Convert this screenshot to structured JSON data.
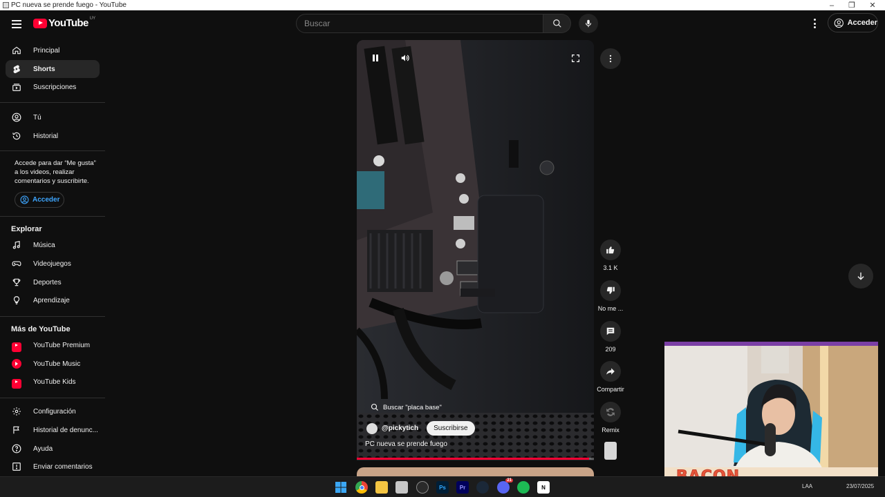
{
  "window": {
    "title": "PC nueva se prende fuego - YouTube",
    "minimize": "–",
    "restore": "❐",
    "close": "✕"
  },
  "header": {
    "logo_text": "YouTube",
    "country_code": "UY",
    "search_placeholder": "Buscar",
    "signin_label": "Acceder"
  },
  "sidebar": {
    "main": [
      {
        "label": "Principal",
        "icon": "home-icon"
      },
      {
        "label": "Shorts",
        "icon": "shorts-icon",
        "active": true
      },
      {
        "label": "Suscripciones",
        "icon": "subscriptions-icon"
      }
    ],
    "you": [
      {
        "label": "Tú",
        "icon": "user-icon"
      },
      {
        "label": "Historial",
        "icon": "history-icon"
      }
    ],
    "signin_prompt": "Accede para dar “Me gusta” a los videos, realizar comentarios y suscribirte.",
    "signin_label": "Acceder",
    "explore_title": "Explorar",
    "explore": [
      {
        "label": "Música",
        "icon": "music-icon"
      },
      {
        "label": "Videojuegos",
        "icon": "gaming-icon"
      },
      {
        "label": "Deportes",
        "icon": "trophy-icon"
      },
      {
        "label": "Aprendizaje",
        "icon": "bulb-icon"
      }
    ],
    "more_title": "Más de YouTube",
    "more": [
      {
        "label": "YouTube Premium",
        "icon": "youtube-premium-icon"
      },
      {
        "label": "YouTube Music",
        "icon": "youtube-music-icon"
      },
      {
        "label": "YouTube Kids",
        "icon": "youtube-kids-icon"
      }
    ],
    "settings": [
      {
        "label": "Configuración",
        "icon": "gear-icon"
      },
      {
        "label": "Historial de denunc...",
        "icon": "flag-icon"
      },
      {
        "label": "Ayuda",
        "icon": "help-icon"
      },
      {
        "label": "Enviar comentarios",
        "icon": "feedback-icon"
      }
    ]
  },
  "short": {
    "search_chip": "Buscar \"placa base\"",
    "channel": "@pickytich",
    "subscribe_label": "Suscribirse",
    "title": "PC nueva se prende fuego",
    "progress": 0.98
  },
  "actions": {
    "likes": "3.1 K",
    "dislike": "No me ...",
    "comments": "209",
    "share": "Compartir",
    "remix": "Remix"
  },
  "webcam": {
    "overlay_text": "BACON"
  },
  "taskbar": {
    "apps": [
      "windows-start-icon",
      "chrome-icon",
      "file-explorer-icon",
      "app-icon",
      "app-icon",
      "photoshop-icon",
      "premiere-icon",
      "steam-icon",
      "discord-icon",
      "spotify-icon",
      "notion-icon"
    ],
    "ps_label": "Ps",
    "pr_label": "Pr",
    "notion_label": "N",
    "discord_badge": "21",
    "lang": "LAA",
    "date": "23/07/2025"
  },
  "colors": {
    "background": "#0f0f0f",
    "accent_red": "#ff0033",
    "link_blue": "#3ea6ff"
  }
}
